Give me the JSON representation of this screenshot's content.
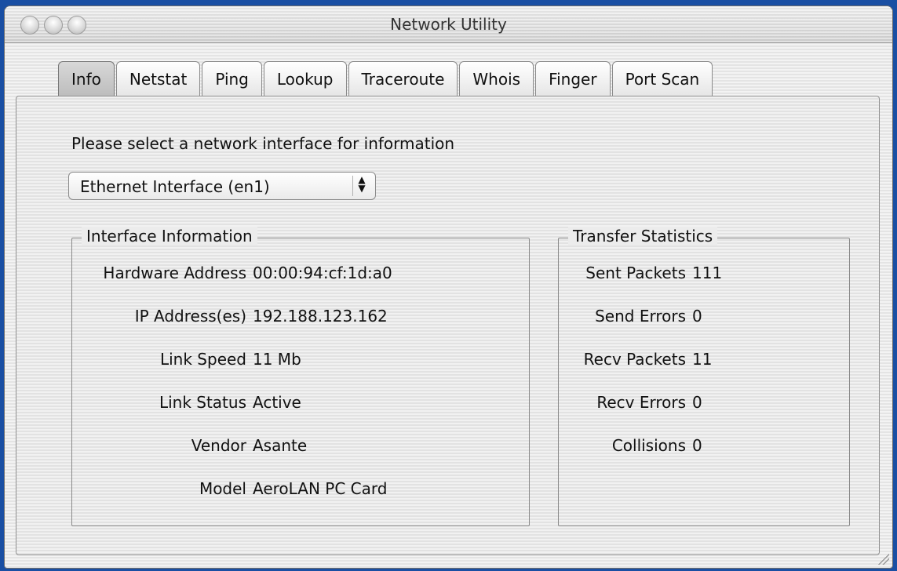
{
  "window": {
    "title": "Network Utility"
  },
  "tabs": [
    {
      "label": "Info",
      "active": true
    },
    {
      "label": "Netstat"
    },
    {
      "label": "Ping"
    },
    {
      "label": "Lookup"
    },
    {
      "label": "Traceroute"
    },
    {
      "label": "Whois"
    },
    {
      "label": "Finger"
    },
    {
      "label": "Port Scan"
    }
  ],
  "info": {
    "prompt": "Please select a network interface for information",
    "interface_select": {
      "value": "Ethernet Interface (en1)"
    }
  },
  "interface_information": {
    "title": "Interface Information",
    "rows": [
      {
        "label": "Hardware Address",
        "value": "00:00:94:cf:1d:a0"
      },
      {
        "label": "IP Address(es)",
        "value": "192.188.123.162"
      },
      {
        "label": "Link Speed",
        "value": "11 Mb"
      },
      {
        "label": "Link Status",
        "value": "Active"
      },
      {
        "label": "Vendor",
        "value": "Asante"
      },
      {
        "label": "Model",
        "value": "AeroLAN PC Card"
      }
    ]
  },
  "transfer_statistics": {
    "title": "Transfer Statistics",
    "rows": [
      {
        "label": "Sent Packets",
        "value": "111"
      },
      {
        "label": "Send Errors",
        "value": "0"
      },
      {
        "label": "Recv Packets",
        "value": "11"
      },
      {
        "label": "Recv Errors",
        "value": "0"
      },
      {
        "label": "Collisions",
        "value": "0"
      }
    ]
  }
}
